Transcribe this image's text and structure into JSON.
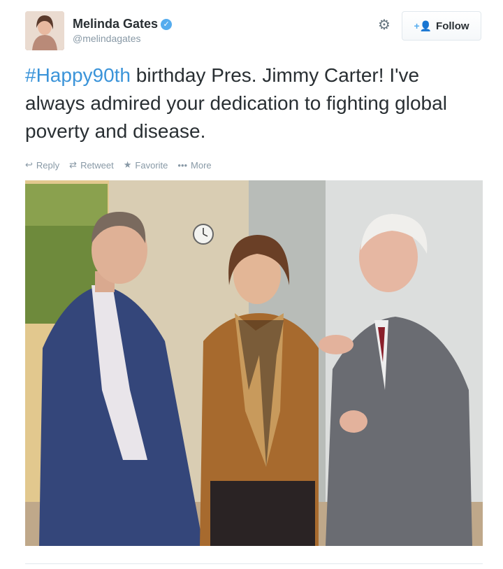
{
  "author": {
    "name": "Melinda Gates",
    "handle": "@melindagates",
    "verified_icon": "verified-badge-icon"
  },
  "header": {
    "settings_icon": "gear-icon",
    "follow_label": "Follow"
  },
  "tweet": {
    "hashtag": "#Happy90th",
    "text_rest": " birthday Pres. Jimmy Carter! I've always admired your dedication to fighting global poverty and disease."
  },
  "actions": {
    "reply": "Reply",
    "retweet": "Retweet",
    "favorite": "Favorite",
    "more": "More"
  },
  "colors": {
    "hashtag": "#3b94d9",
    "verified": "#55acee",
    "muted": "#8899a6"
  }
}
